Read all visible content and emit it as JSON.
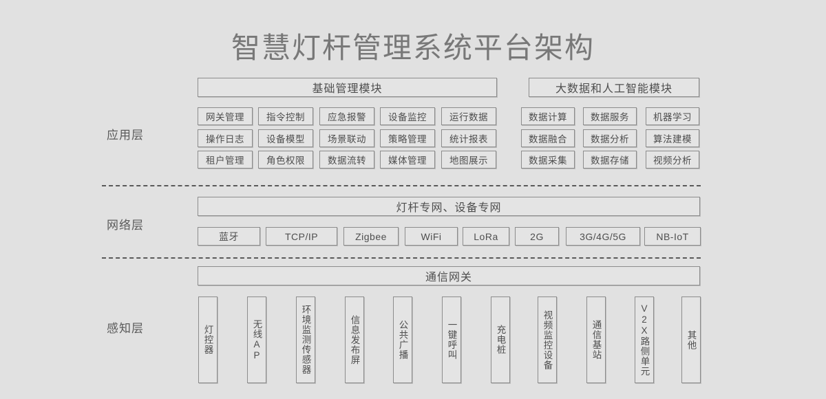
{
  "title": "智慧灯杆管理系统平台架构",
  "layers": {
    "application": {
      "label": "应用层"
    },
    "network": {
      "label": "网络层"
    },
    "perception": {
      "label": "感知层"
    }
  },
  "application": {
    "basic_module": {
      "header": "基础管理模块",
      "items": [
        "网关管理",
        "指令控制",
        "应急报警",
        "设备监控",
        "运行数据",
        "操作日志",
        "设备模型",
        "场景联动",
        "策略管理",
        "统计报表",
        "租户管理",
        "角色权限",
        "数据流转",
        "媒体管理",
        "地图展示"
      ]
    },
    "bigdata_module": {
      "header": "大数据和人工智能模块",
      "items": [
        "数据计算",
        "数据服务",
        "机器学习",
        "数据融合",
        "数据分析",
        "算法建模",
        "数据采集",
        "数据存储",
        "视频分析"
      ]
    }
  },
  "network": {
    "header": "灯杆专网、设备专网",
    "technologies": [
      "蓝牙",
      "TCP/IP",
      "Zigbee",
      "WiFi",
      "LoRa",
      "2G",
      "3G/4G/5G",
      "NB-IoT"
    ]
  },
  "perception": {
    "header": "通信网关",
    "devices": [
      "灯控器",
      "无线AP",
      "环境监测传感器",
      "信息发布屏",
      "公共广播",
      "一键呼叫",
      "充电桩",
      "视频监控设备",
      "通信基站",
      "V2X路侧单元",
      "其他"
    ]
  },
  "colors": {
    "background": "#e1e1e1",
    "box_fill": "#e4e4e4",
    "box_border": "#8c8c8c",
    "title_text": "#787878",
    "body_text": "#4e4e4e",
    "divider": "#585858"
  }
}
